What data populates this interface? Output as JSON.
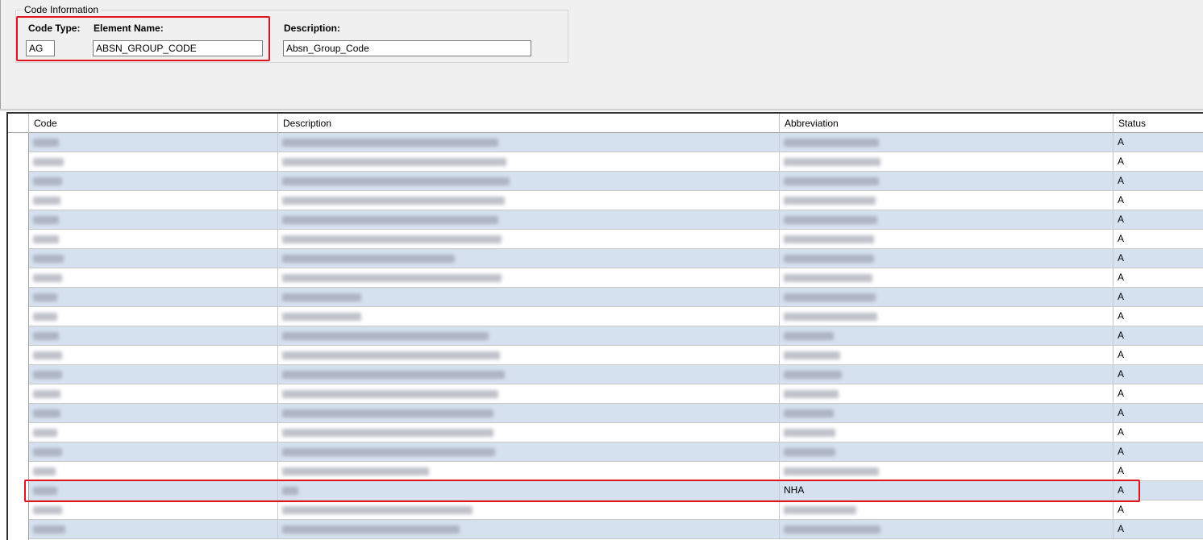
{
  "code_info": {
    "group_title": "Code Information",
    "code_type_label": "Code Type:",
    "element_name_label": "Element Name:",
    "description_label": "Description:",
    "code_type_value": "AG",
    "element_name_value": "ABSN_GROUP_CODE",
    "description_value": "Absn_Group_Code"
  },
  "grid": {
    "columns": [
      "Code",
      "Description",
      "Abbreviation",
      "Status"
    ],
    "rows": [
      {
        "code": "",
        "description": "",
        "abbreviation": "",
        "status": "A",
        "redacted": true
      },
      {
        "code": "",
        "description": "",
        "abbreviation": "",
        "status": "A",
        "redacted": true
      },
      {
        "code": "",
        "description": "",
        "abbreviation": "",
        "status": "A",
        "redacted": true
      },
      {
        "code": "",
        "description": "",
        "abbreviation": "",
        "status": "A",
        "redacted": true
      },
      {
        "code": "",
        "description": "",
        "abbreviation": "",
        "status": "A",
        "redacted": true
      },
      {
        "code": "",
        "description": "",
        "abbreviation": "",
        "status": "A",
        "redacted": true
      },
      {
        "code": "",
        "description": "",
        "abbreviation": "",
        "status": "A",
        "redacted": true
      },
      {
        "code": "",
        "description": "",
        "abbreviation": "",
        "status": "A",
        "redacted": true
      },
      {
        "code": "",
        "description": "",
        "abbreviation": "",
        "status": "A",
        "redacted": true
      },
      {
        "code": "",
        "description": "",
        "abbreviation": "",
        "status": "A",
        "redacted": true
      },
      {
        "code": "",
        "description": "",
        "abbreviation": "",
        "status": "A",
        "redacted": true
      },
      {
        "code": "",
        "description": "",
        "abbreviation": "",
        "status": "A",
        "redacted": true
      },
      {
        "code": "",
        "description": "",
        "abbreviation": "",
        "status": "A",
        "redacted": true
      },
      {
        "code": "",
        "description": "",
        "abbreviation": "",
        "status": "A",
        "redacted": true
      },
      {
        "code": "",
        "description": "",
        "abbreviation": "",
        "status": "A",
        "redacted": true
      },
      {
        "code": "",
        "description": "",
        "abbreviation": "",
        "status": "A",
        "redacted": true
      },
      {
        "code": "",
        "description": "",
        "abbreviation": "",
        "status": "A",
        "redacted": true
      },
      {
        "code": "",
        "description": "",
        "abbreviation": "",
        "status": "A",
        "redacted": true
      },
      {
        "code": "",
        "description": "",
        "abbreviation": "NHA",
        "status": "A",
        "redacted": true,
        "highlighted": true
      },
      {
        "code": "",
        "description": "",
        "abbreviation": "",
        "status": "A",
        "redacted": true
      },
      {
        "code": "",
        "description": "",
        "abbreviation": "",
        "status": "A",
        "redacted": true
      }
    ]
  },
  "colors": {
    "highlight": "#e0141e",
    "alt_row": "#d6e1ef",
    "panel_bg": "#f0f0f0"
  }
}
